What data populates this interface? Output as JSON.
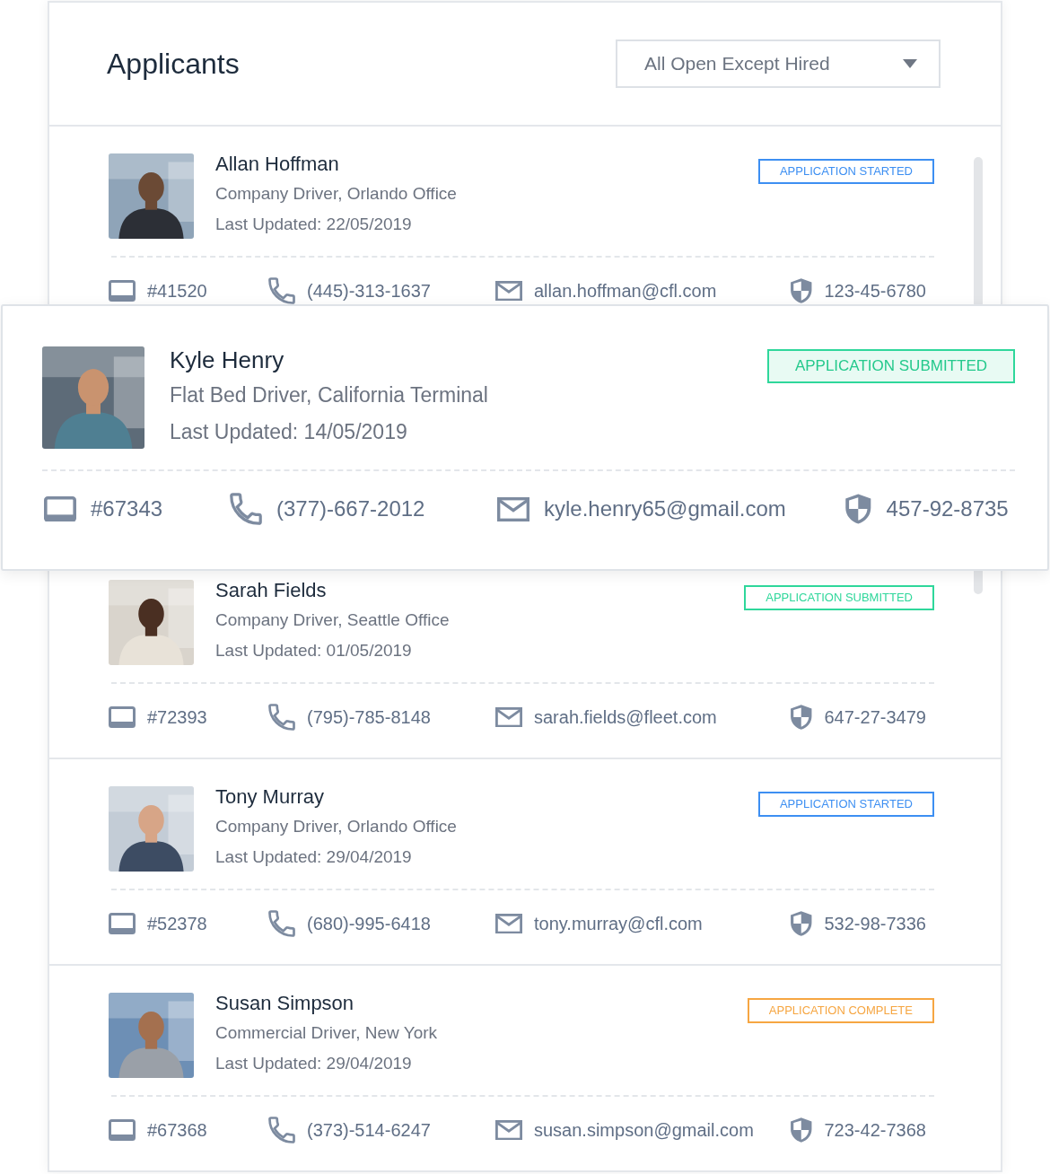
{
  "header": {
    "title": "Applicants",
    "filter": {
      "value": "All Open Except Hired"
    }
  },
  "applicants": [
    {
      "name": "Allan Hoffman",
      "role": "Company Driver, Orlando Office",
      "updated": "Last Updated: 22/05/2019",
      "status": {
        "label": "APPLICATION STARTED",
        "kind": "started"
      },
      "id": "#41520",
      "phone": "(445)-313-1637",
      "email": "allan.hoffman@cfl.com",
      "ssn": "123-45-6780",
      "featured": false
    },
    {
      "name": "Kyle Henry",
      "role": "Flat Bed Driver, California Terminal",
      "updated": "Last Updated: 14/05/2019",
      "status": {
        "label": "APPLICATION SUBMITTED",
        "kind": "submitted"
      },
      "id": "#67343",
      "phone": "(377)-667-2012",
      "email": "kyle.henry65@gmail.com",
      "ssn": "457-92-8735",
      "featured": true
    },
    {
      "name": "Sarah Fields",
      "role": "Company Driver, Seattle Office",
      "updated": "Last Updated: 01/05/2019",
      "status": {
        "label": "APPLICATION SUBMITTED",
        "kind": "submitted"
      },
      "id": "#72393",
      "phone": "(795)-785-8148",
      "email": "sarah.fields@fleet.com",
      "ssn": "647-27-3479",
      "featured": false
    },
    {
      "name": "Tony Murray",
      "role": "Company Driver, Orlando Office",
      "updated": "Last Updated: 29/04/2019",
      "status": {
        "label": "APPLICATION STARTED",
        "kind": "started"
      },
      "id": "#52378",
      "phone": "(680)-995-6418",
      "email": "tony.murray@cfl.com",
      "ssn": "532-98-7336",
      "featured": false
    },
    {
      "name": "Susan Simpson",
      "role": "Commercial Driver, New York",
      "updated": "Last Updated: 29/04/2019",
      "status": {
        "label": "APPLICATION COMPLETE",
        "kind": "complete"
      },
      "id": "#67368",
      "phone": "(373)-514-6247",
      "email": "susan.simpson@gmail.com",
      "ssn": "723-42-7368",
      "featured": false
    }
  ]
}
